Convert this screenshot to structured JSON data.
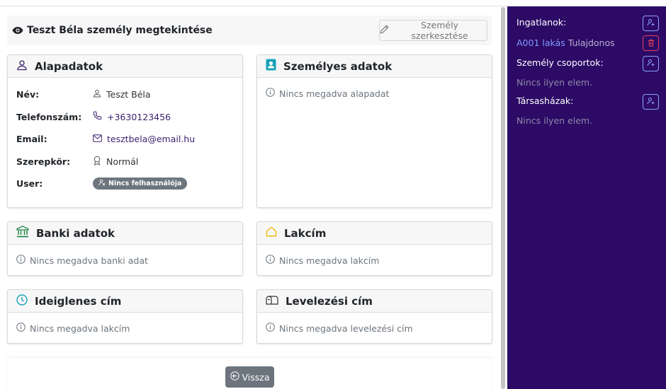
{
  "header": {
    "title": "Teszt Béla személy megtekintése",
    "edit_label": "Személy szerkesztése"
  },
  "cards": {
    "basic": {
      "title": "Alapadatok",
      "rows": [
        {
          "label": "Név:",
          "value": "Teszt Béla"
        },
        {
          "label": "Telefonszám:",
          "value": "+3630123456"
        },
        {
          "label": "Email:",
          "value": "tesztbela@email.hu"
        },
        {
          "label": "Szerepkör:",
          "value": "Normál"
        },
        {
          "label": "User:",
          "value": "Nincs felhasználója"
        }
      ]
    },
    "personal": {
      "title": "Személyes adatok",
      "empty": "Nincs megadva alapadat"
    },
    "bank": {
      "title": "Banki adatok",
      "empty": "Nincs megadva banki adat"
    },
    "address": {
      "title": "Lakcím",
      "empty": "Nincs megadva lakcím"
    },
    "temp_address": {
      "title": "Ideiglenes cím",
      "empty": "Nincs megadva lakcím"
    },
    "mail_address": {
      "title": "Levelezési cím",
      "empty": "Nincs megadva levelezési cím"
    }
  },
  "footer": {
    "back_label": "Vissza"
  },
  "sidebar": {
    "properties": {
      "title": "Ingatlanok:",
      "item_link": "A001 lakás",
      "item_role": "Tulajdonos"
    },
    "groups": {
      "title": "Személy csoportok:",
      "empty": "Nincs ilyen elem."
    },
    "condos": {
      "title": "Társasházak:",
      "empty": "Nincs ilyen elem."
    }
  },
  "colors": {
    "sidebar_bg": "#2c0a66",
    "accent_link": "#7f9bff",
    "danger": "#e0435a",
    "secondary_button": "#6c757d"
  }
}
